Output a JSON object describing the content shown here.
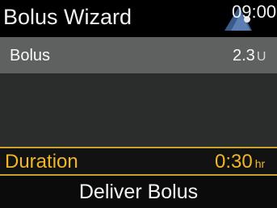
{
  "header": {
    "title": "Bolus Wizard",
    "time": "09:00",
    "icon": "notification-marker-icon"
  },
  "bolus": {
    "label": "Bolus",
    "value": "2.3",
    "unit": "U"
  },
  "duration": {
    "label": "Duration",
    "value": "0:30",
    "unit": "hr"
  },
  "footer": {
    "button_label": "Deliver Bolus"
  },
  "colors": {
    "accent": "#f0b726",
    "row_band": "#5e6160",
    "background": "#000000",
    "content_background": "#2a2d2c"
  }
}
